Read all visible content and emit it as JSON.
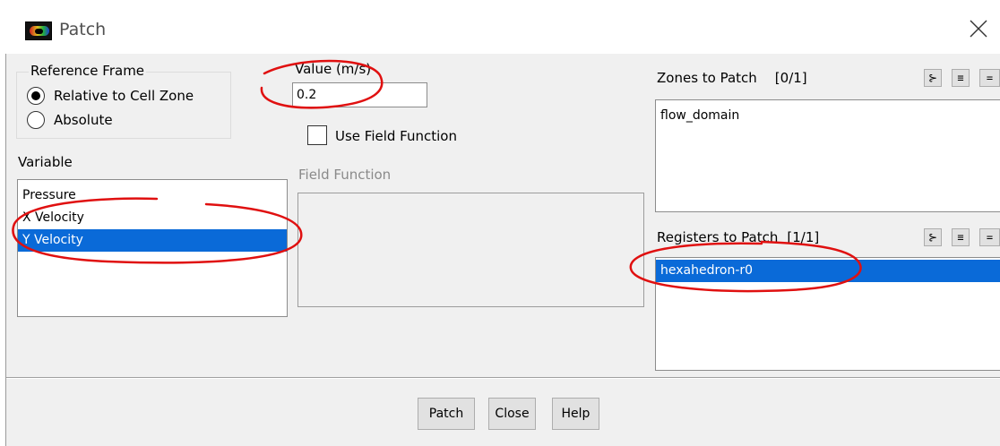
{
  "window": {
    "title": "Patch",
    "app_icon": "fluent-logo-icon",
    "close_icon": "close-x-icon"
  },
  "reference_frame": {
    "label": "Reference Frame",
    "options": [
      {
        "label": "Relative to Cell Zone",
        "checked": true
      },
      {
        "label": "Absolute",
        "checked": false
      }
    ]
  },
  "variable": {
    "label": "Variable",
    "items": [
      {
        "label": "Pressure",
        "selected": false
      },
      {
        "label": "X Velocity",
        "selected": false
      },
      {
        "label": "Y Velocity",
        "selected": true
      }
    ]
  },
  "value": {
    "label": "Value (m/s)",
    "input": "0.2"
  },
  "field_function": {
    "checkbox_label": "Use Field Function",
    "checked": false,
    "label": "Field Function"
  },
  "zones": {
    "label": "Zones to Patch",
    "count": "[0/1]",
    "items": [
      {
        "label": "flow_domain",
        "selected": false
      }
    ]
  },
  "registers": {
    "label": "Registers to Patch",
    "count": "[1/1]",
    "items": [
      {
        "label": "hexahedron-r0",
        "selected": true
      }
    ]
  },
  "toolbar_icons": [
    "select-all-icon",
    "deselect-all-icon",
    "list-icon"
  ],
  "buttons": {
    "patch": "Patch",
    "close": "Close",
    "help": "Help"
  },
  "colors": {
    "selection": "#0a6ad8",
    "annotation": "#e01010"
  }
}
